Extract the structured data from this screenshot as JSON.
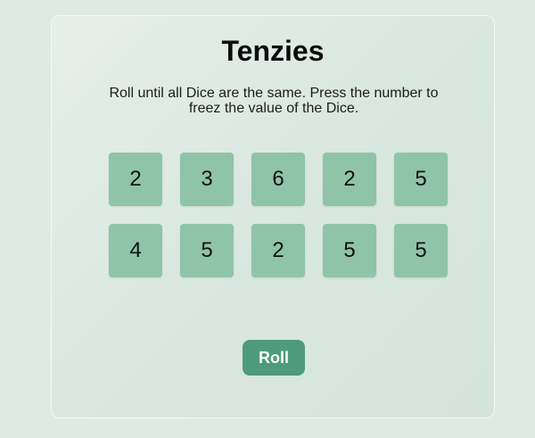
{
  "game": {
    "title": "Tenzies",
    "instructions": "Roll until all Dice are the same. Press the number to freez the value of the Dice.",
    "dice": [
      "2",
      "3",
      "6",
      "2",
      "5",
      "4",
      "5",
      "2",
      "5",
      "5"
    ],
    "roll_label": "Roll"
  },
  "colors": {
    "background": "#dfeae3",
    "die": "#8fc4a9",
    "roll_button": "#4d9a7c",
    "title": "#0b0b0b"
  }
}
